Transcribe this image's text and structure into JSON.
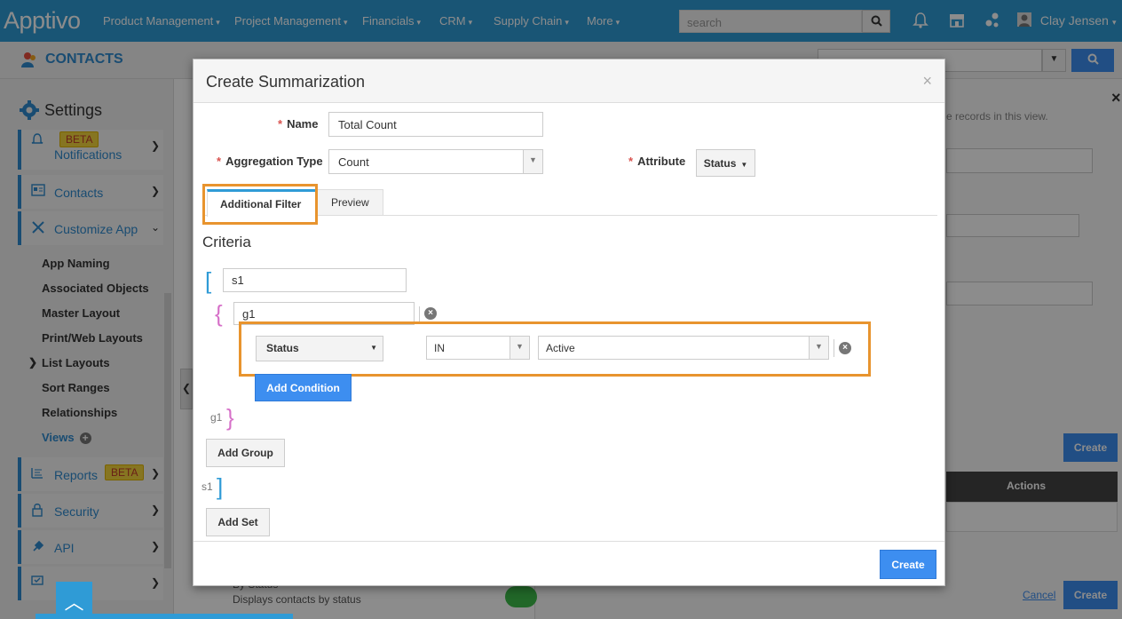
{
  "app": {
    "logo": "Apptivo"
  },
  "topnav": {
    "items": [
      "Product Management",
      "Project Management",
      "Financials",
      "CRM",
      "Supply Chain",
      "More"
    ],
    "search_placeholder": "search",
    "user_name": "Clay Jensen"
  },
  "header": {
    "title": "CONTACTS"
  },
  "sidebar": {
    "settings_title": "Settings",
    "items": [
      {
        "label": "Notifications",
        "badge": "BETA"
      },
      {
        "label": "Contacts"
      },
      {
        "label": "Customize App"
      }
    ],
    "sub_items": [
      "App Naming",
      "Associated Objects",
      "Master Layout",
      "Print/Web Layouts",
      "List Layouts",
      "Sort Ranges",
      "Relationships",
      "Views"
    ],
    "items_bottom": [
      {
        "label": "Reports",
        "badge": "BETA"
      },
      {
        "label": "Security"
      },
      {
        "label": "API"
      }
    ]
  },
  "background": {
    "hint": "e records in this view.",
    "create_label": "Create",
    "actions_header": "Actions",
    "cancel_label": "Cancel",
    "create2_label": "Create",
    "view_name": "By Status",
    "view_desc": "Displays contacts by status"
  },
  "modal": {
    "title": "Create Summarization",
    "close": "×",
    "name_label": "Name",
    "name_value": "Total Count",
    "aggregation_label": "Aggregation Type",
    "aggregation_value": "Count",
    "attribute_label": "Attribute",
    "attribute_value": "Status",
    "tabs": [
      "Additional Filter",
      "Preview"
    ],
    "criteria_title": "Criteria",
    "set_name": "s1",
    "group_name": "g1",
    "condition": {
      "field": "Status",
      "operator": "IN",
      "value": "Active"
    },
    "add_condition": "Add Condition",
    "group_close_label": "g1",
    "add_group": "Add Group",
    "set_close_label": "s1",
    "add_set": "Add Set",
    "create": "Create"
  },
  "colors": {
    "brand": "#2f9bd6",
    "highlight": "#e8942e",
    "primary_button": "#3d8ef0"
  }
}
